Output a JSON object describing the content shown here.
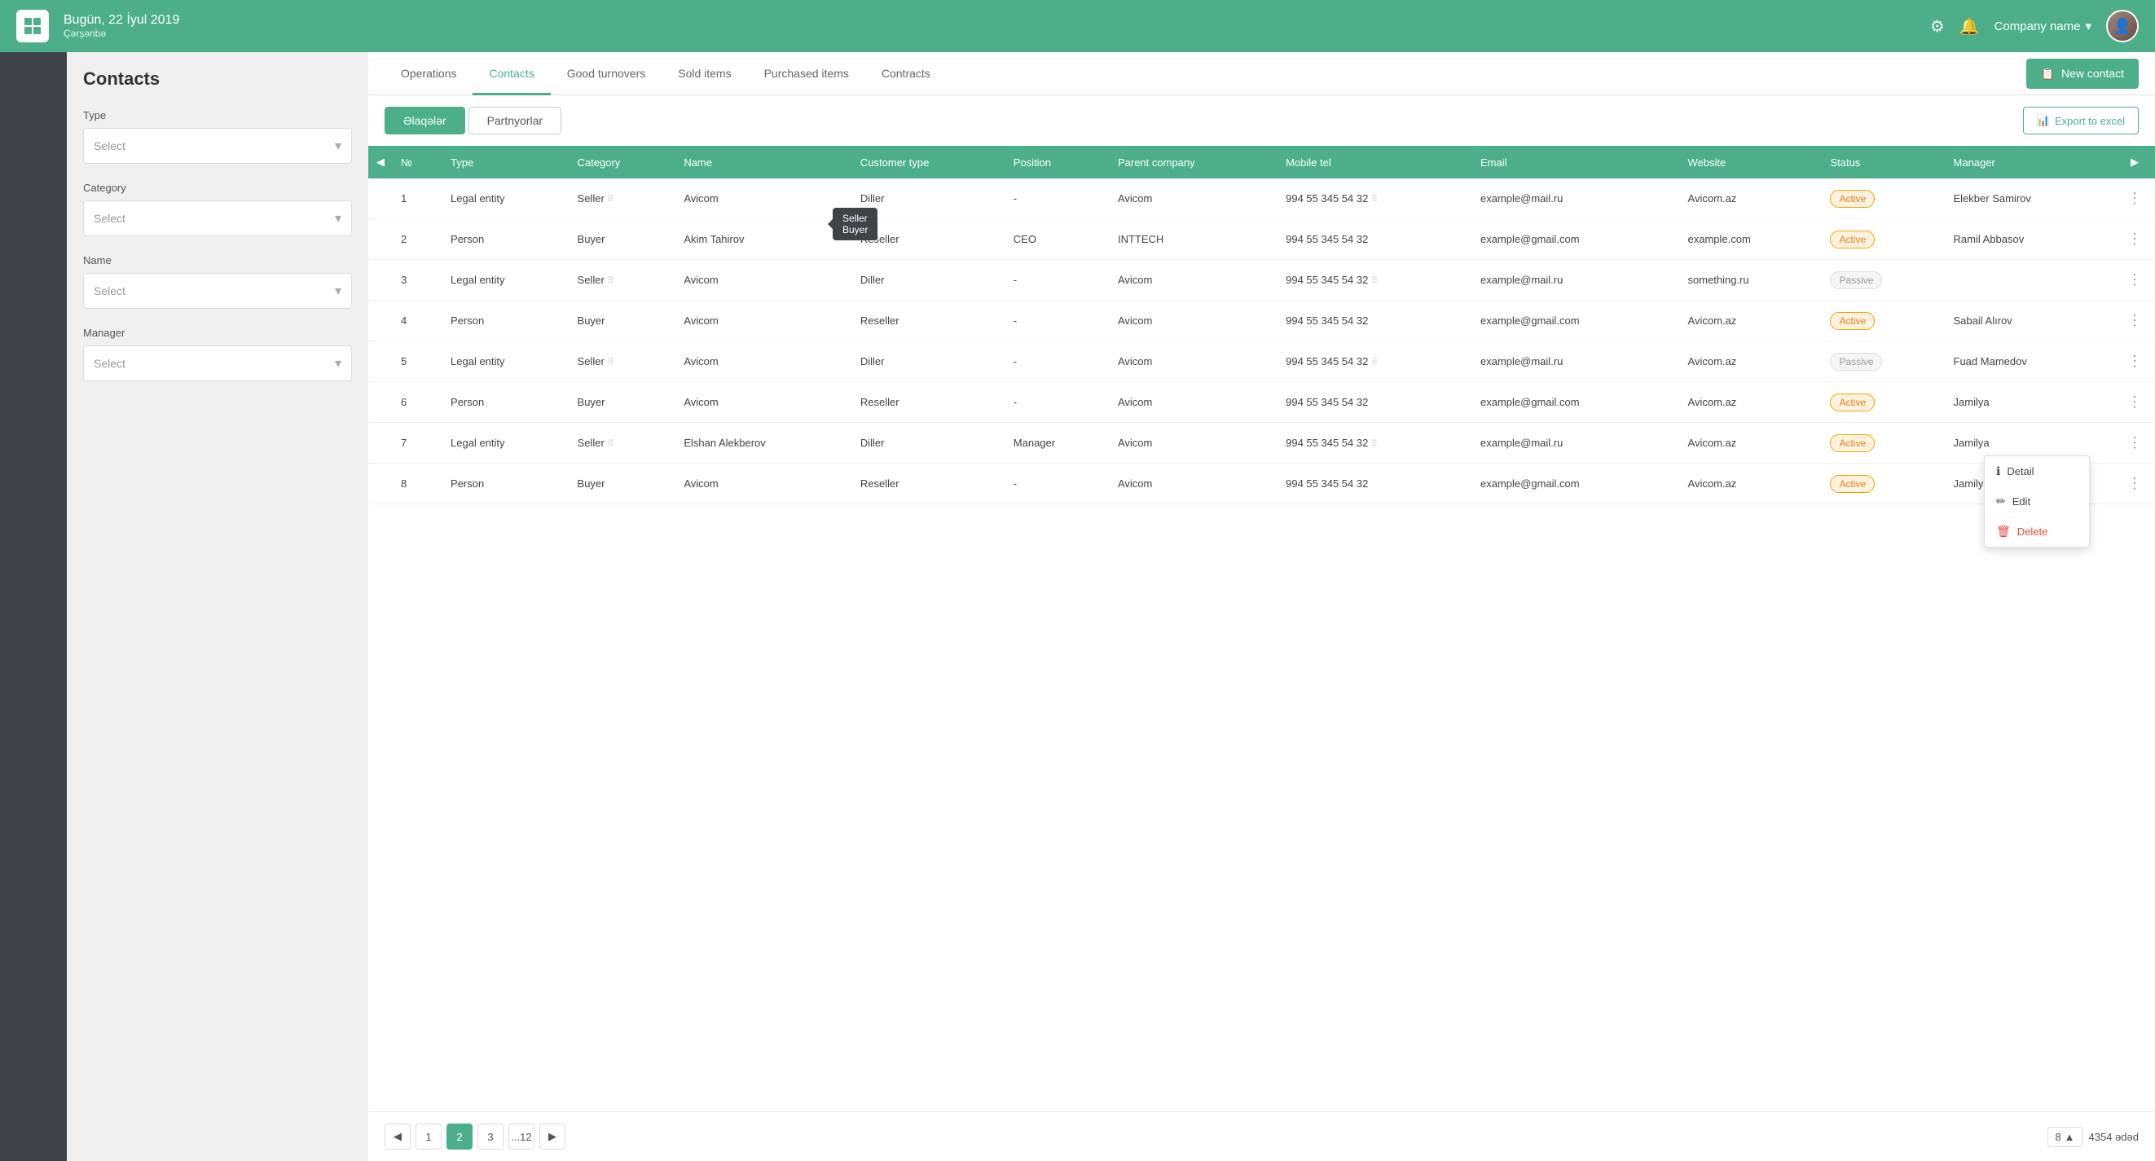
{
  "header": {
    "date": "Bugün, 22 İyul 2019",
    "day": "Çərşənbə",
    "company": "Company name",
    "settings_icon": "⚙",
    "bell_icon": "🔔",
    "chevron_icon": "▾"
  },
  "sidebar": {},
  "left_panel": {
    "title": "Contacts",
    "filters": [
      {
        "id": "type",
        "label": "Type",
        "placeholder": "Select"
      },
      {
        "id": "category",
        "label": "Category",
        "placeholder": "Select"
      },
      {
        "id": "name",
        "label": "Name",
        "placeholder": "Select"
      },
      {
        "id": "manager",
        "label": "Manager",
        "placeholder": "Select"
      }
    ]
  },
  "tabs": [
    {
      "id": "operations",
      "label": "Operations",
      "active": false
    },
    {
      "id": "contacts",
      "label": "Contacts",
      "active": true
    },
    {
      "id": "good-turnovers",
      "label": "Good turnovers",
      "active": false
    },
    {
      "id": "sold-items",
      "label": "Sold items",
      "active": false
    },
    {
      "id": "purchased-items",
      "label": "Purchased items",
      "active": false
    },
    {
      "id": "contracts",
      "label": "Contracts",
      "active": false
    }
  ],
  "new_contact_btn": "New contact",
  "sub_tabs": [
    {
      "id": "elaqeler",
      "label": "Əlaqələr",
      "active": true
    },
    {
      "id": "partnyorlar",
      "label": "Partnyorlar",
      "active": false
    }
  ],
  "export_btn": "Export to excel",
  "table": {
    "columns": [
      "№",
      "Type",
      "Category",
      "Name",
      "Customer type",
      "Position",
      "Parent company",
      "Mobile tel",
      "Email",
      "Website",
      "Status",
      "Manager"
    ],
    "rows": [
      {
        "no": 1,
        "type": "Legal entity",
        "category": "Seller",
        "name": "Avicom",
        "customer_type": "Diller",
        "position": "-",
        "parent_company": "Avicom",
        "mobile": "994 55 345 54 32",
        "email": "example@mail.ru",
        "website": "Avicom.az",
        "status": "Active",
        "manager": "Elekber Samirov"
      },
      {
        "no": 2,
        "type": "Person",
        "category": "Buyer",
        "name": "Akim Tahirov",
        "customer_type": "Reseller",
        "position": "CEO",
        "parent_company": "INTTECH",
        "mobile": "994 55 345 54 32",
        "email": "example@gmail.com",
        "website": "example.com",
        "status": "Active",
        "manager": "Ramil Abbasov"
      },
      {
        "no": 3,
        "type": "Legal entity",
        "category": "Seller",
        "name": "Avicom",
        "customer_type": "Diller",
        "position": "-",
        "parent_company": "Avicom",
        "mobile": "994 55 345 54 32",
        "email": "example@mail.ru",
        "website": "something.ru",
        "status": "Passive",
        "manager": ""
      },
      {
        "no": 4,
        "type": "Person",
        "category": "Buyer",
        "name": "Avicom",
        "customer_type": "Reseller",
        "position": "-",
        "parent_company": "Avicom",
        "mobile": "994 55 345 54 32",
        "email": "example@gmail.com",
        "website": "Avicom.az",
        "status": "Active",
        "manager": "Sabail Alırov"
      },
      {
        "no": 5,
        "type": "Legal entity",
        "category": "Seller",
        "name": "Avicom",
        "customer_type": "Diller",
        "position": "-",
        "parent_company": "Avicom",
        "mobile": "994 55 345 54 32",
        "email": "example@mail.ru",
        "website": "Avicom.az",
        "status": "Passive",
        "manager": "Fuad Mamedov"
      },
      {
        "no": 6,
        "type": "Person",
        "category": "Buyer",
        "name": "Avicom",
        "customer_type": "Reseller",
        "position": "-",
        "parent_company": "Avicom",
        "mobile": "994 55 345 54 32",
        "email": "example@gmail.com",
        "website": "Avicom.az",
        "status": "Active",
        "manager": "Jamilya"
      },
      {
        "no": 7,
        "type": "Legal entity",
        "category": "Seller",
        "name": "Elshan Alekberov",
        "customer_type": "Diller",
        "position": "Manager",
        "parent_company": "Avicom",
        "mobile": "994 55 345 54 32",
        "email": "example@mail.ru",
        "website": "Avicom.az",
        "status": "Active",
        "manager": "Jamilya"
      },
      {
        "no": 8,
        "type": "Person",
        "category": "Buyer",
        "name": "Avicom",
        "customer_type": "Reseller",
        "position": "-",
        "parent_company": "Avicom",
        "mobile": "994 55 345 54 32",
        "email": "example@gmail.com",
        "website": "Avicom.az",
        "status": "Active",
        "manager": "Jamilya"
      }
    ]
  },
  "context_menu": {
    "items": [
      {
        "id": "detail",
        "label": "Detail",
        "icon": "ℹ"
      },
      {
        "id": "edit",
        "label": "Edit",
        "icon": "✏"
      },
      {
        "id": "delete",
        "label": "Delete",
        "icon": "🗑"
      }
    ]
  },
  "tooltip": {
    "line1": "Seller",
    "line2": "Buyer"
  },
  "pagination": {
    "pages": [
      "1",
      "2",
      "3",
      "...12"
    ],
    "active_page": "2",
    "per_page": "8",
    "total": "4354 ədəd"
  }
}
